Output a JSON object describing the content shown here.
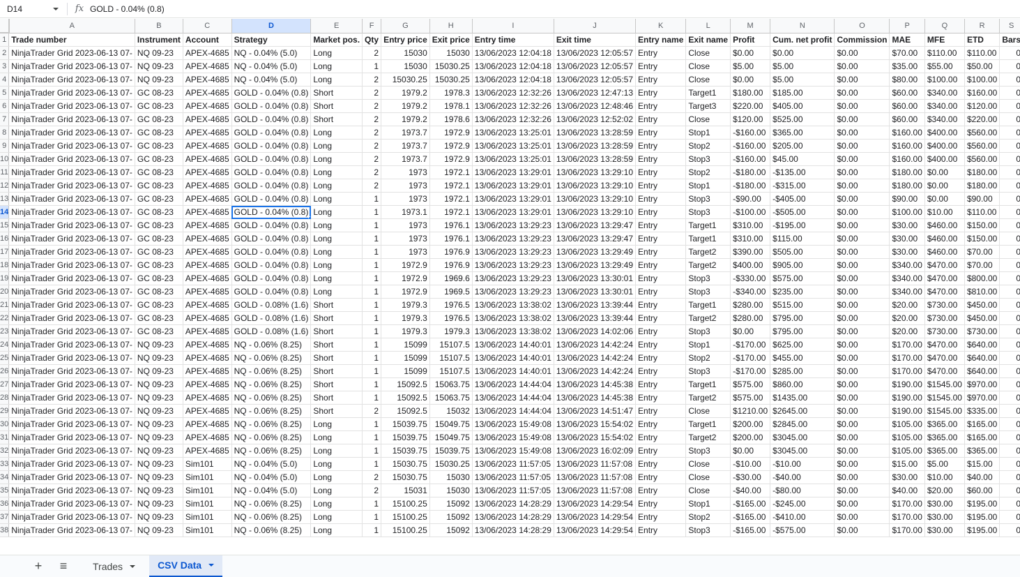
{
  "formula_bar": {
    "cell_ref": "D14",
    "fx": "fx",
    "formula": "GOLD - 0.04% (0.8)"
  },
  "selected": {
    "row": 14,
    "col": "D"
  },
  "columns": [
    "A",
    "B",
    "C",
    "D",
    "E",
    "F",
    "G",
    "H",
    "I",
    "J",
    "K",
    "L",
    "M",
    "N",
    "O",
    "P",
    "Q",
    "R",
    "S"
  ],
  "numeric_columns": [
    "F",
    "G",
    "H",
    "S"
  ],
  "headers": [
    "Trade number",
    "Instrument",
    "Account",
    "Strategy",
    "Market pos.",
    "Qty",
    "Entry price",
    "Exit price",
    "Entry time",
    "Exit time",
    "Entry name",
    "Exit name",
    "Profit",
    "Cum. net profit",
    "Commission",
    "MAE",
    "MFE",
    "ETD",
    "Bars"
  ],
  "rows": [
    [
      "NinjaTrader Grid 2023-06-13 07-",
      "NQ 09-23",
      "APEX-4685",
      "NQ - 0.04% (5.0)",
      "Long",
      "2",
      "15030",
      "15030",
      "13/06/2023 12:04:18",
      "13/06/2023 12:05:57",
      "Entry",
      "Close",
      "$0.00",
      "$0.00",
      "$0.00",
      "$70.00",
      "$110.00",
      "$110.00",
      "0"
    ],
    [
      "NinjaTrader Grid 2023-06-13 07-",
      "NQ 09-23",
      "APEX-4685",
      "NQ - 0.04% (5.0)",
      "Long",
      "1",
      "15030",
      "15030.25",
      "13/06/2023 12:04:18",
      "13/06/2023 12:05:57",
      "Entry",
      "Close",
      "$5.00",
      "$5.00",
      "$0.00",
      "$35.00",
      "$55.00",
      "$50.00",
      "0"
    ],
    [
      "NinjaTrader Grid 2023-06-13 07-",
      "NQ 09-23",
      "APEX-4685",
      "NQ - 0.04% (5.0)",
      "Long",
      "2",
      "15030.25",
      "15030.25",
      "13/06/2023 12:04:18",
      "13/06/2023 12:05:57",
      "Entry",
      "Close",
      "$0.00",
      "$5.00",
      "$0.00",
      "$80.00",
      "$100.00",
      "$100.00",
      "0"
    ],
    [
      "NinjaTrader Grid 2023-06-13 07-",
      "GC 08-23",
      "APEX-4685",
      "GOLD - 0.04% (0.8)",
      "Short",
      "2",
      "1979.2",
      "1978.3",
      "13/06/2023 12:32:26",
      "13/06/2023 12:47:13",
      "Entry",
      "Target1",
      "$180.00",
      "$185.00",
      "$0.00",
      "$60.00",
      "$340.00",
      "$160.00",
      "0"
    ],
    [
      "NinjaTrader Grid 2023-06-13 07-",
      "GC 08-23",
      "APEX-4685",
      "GOLD - 0.04% (0.8)",
      "Short",
      "2",
      "1979.2",
      "1978.1",
      "13/06/2023 12:32:26",
      "13/06/2023 12:48:46",
      "Entry",
      "Target3",
      "$220.00",
      "$405.00",
      "$0.00",
      "$60.00",
      "$340.00",
      "$120.00",
      "0"
    ],
    [
      "NinjaTrader Grid 2023-06-13 07-",
      "GC 08-23",
      "APEX-4685",
      "GOLD - 0.04% (0.8)",
      "Short",
      "2",
      "1979.2",
      "1978.6",
      "13/06/2023 12:32:26",
      "13/06/2023 12:52:02",
      "Entry",
      "Close",
      "$120.00",
      "$525.00",
      "$0.00",
      "$60.00",
      "$340.00",
      "$220.00",
      "0"
    ],
    [
      "NinjaTrader Grid 2023-06-13 07-",
      "GC 08-23",
      "APEX-4685",
      "GOLD - 0.04% (0.8)",
      "Long",
      "2",
      "1973.7",
      "1972.9",
      "13/06/2023 13:25:01",
      "13/06/2023 13:28:59",
      "Entry",
      "Stop1",
      "-$160.00",
      "$365.00",
      "$0.00",
      "$160.00",
      "$400.00",
      "$560.00",
      "0"
    ],
    [
      "NinjaTrader Grid 2023-06-13 07-",
      "GC 08-23",
      "APEX-4685",
      "GOLD - 0.04% (0.8)",
      "Long",
      "2",
      "1973.7",
      "1972.9",
      "13/06/2023 13:25:01",
      "13/06/2023 13:28:59",
      "Entry",
      "Stop2",
      "-$160.00",
      "$205.00",
      "$0.00",
      "$160.00",
      "$400.00",
      "$560.00",
      "0"
    ],
    [
      "NinjaTrader Grid 2023-06-13 07-",
      "GC 08-23",
      "APEX-4685",
      "GOLD - 0.04% (0.8)",
      "Long",
      "2",
      "1973.7",
      "1972.9",
      "13/06/2023 13:25:01",
      "13/06/2023 13:28:59",
      "Entry",
      "Stop3",
      "-$160.00",
      "$45.00",
      "$0.00",
      "$160.00",
      "$400.00",
      "$560.00",
      "0"
    ],
    [
      "NinjaTrader Grid 2023-06-13 07-",
      "GC 08-23",
      "APEX-4685",
      "GOLD - 0.04% (0.8)",
      "Long",
      "2",
      "1973",
      "1972.1",
      "13/06/2023 13:29:01",
      "13/06/2023 13:29:10",
      "Entry",
      "Stop2",
      "-$180.00",
      "-$135.00",
      "$0.00",
      "$180.00",
      "$0.00",
      "$180.00",
      "0"
    ],
    [
      "NinjaTrader Grid 2023-06-13 07-",
      "GC 08-23",
      "APEX-4685",
      "GOLD - 0.04% (0.8)",
      "Long",
      "2",
      "1973",
      "1972.1",
      "13/06/2023 13:29:01",
      "13/06/2023 13:29:10",
      "Entry",
      "Stop1",
      "-$180.00",
      "-$315.00",
      "$0.00",
      "$180.00",
      "$0.00",
      "$180.00",
      "0"
    ],
    [
      "NinjaTrader Grid 2023-06-13 07-",
      "GC 08-23",
      "APEX-4685",
      "GOLD - 0.04% (0.8)",
      "Long",
      "1",
      "1973",
      "1972.1",
      "13/06/2023 13:29:01",
      "13/06/2023 13:29:10",
      "Entry",
      "Stop3",
      "-$90.00",
      "-$405.00",
      "$0.00",
      "$90.00",
      "$0.00",
      "$90.00",
      "0"
    ],
    [
      "NinjaTrader Grid 2023-06-13 07-",
      "GC 08-23",
      "APEX-4685",
      "GOLD - 0.04% (0.8)",
      "Long",
      "1",
      "1973.1",
      "1972.1",
      "13/06/2023 13:29:01",
      "13/06/2023 13:29:10",
      "Entry",
      "Stop3",
      "-$100.00",
      "-$505.00",
      "$0.00",
      "$100.00",
      "$10.00",
      "$110.00",
      "0"
    ],
    [
      "NinjaTrader Grid 2023-06-13 07-",
      "GC 08-23",
      "APEX-4685",
      "GOLD - 0.04% (0.8)",
      "Long",
      "1",
      "1973",
      "1976.1",
      "13/06/2023 13:29:23",
      "13/06/2023 13:29:47",
      "Entry",
      "Target1",
      "$310.00",
      "-$195.00",
      "$0.00",
      "$30.00",
      "$460.00",
      "$150.00",
      "0"
    ],
    [
      "NinjaTrader Grid 2023-06-13 07-",
      "GC 08-23",
      "APEX-4685",
      "GOLD - 0.04% (0.8)",
      "Long",
      "1",
      "1973",
      "1976.1",
      "13/06/2023 13:29:23",
      "13/06/2023 13:29:47",
      "Entry",
      "Target1",
      "$310.00",
      "$115.00",
      "$0.00",
      "$30.00",
      "$460.00",
      "$150.00",
      "0"
    ],
    [
      "NinjaTrader Grid 2023-06-13 07-",
      "GC 08-23",
      "APEX-4685",
      "GOLD - 0.04% (0.8)",
      "Long",
      "1",
      "1973",
      "1976.9",
      "13/06/2023 13:29:23",
      "13/06/2023 13:29:49",
      "Entry",
      "Target2",
      "$390.00",
      "$505.00",
      "$0.00",
      "$30.00",
      "$460.00",
      "$70.00",
      "0"
    ],
    [
      "NinjaTrader Grid 2023-06-13 07-",
      "GC 08-23",
      "APEX-4685",
      "GOLD - 0.04% (0.8)",
      "Long",
      "1",
      "1972.9",
      "1976.9",
      "13/06/2023 13:29:23",
      "13/06/2023 13:29:49",
      "Entry",
      "Target2",
      "$400.00",
      "$905.00",
      "$0.00",
      "$340.00",
      "$470.00",
      "$70.00",
      "0"
    ],
    [
      "NinjaTrader Grid 2023-06-13 07-",
      "GC 08-23",
      "APEX-4685",
      "GOLD - 0.04% (0.8)",
      "Long",
      "1",
      "1972.9",
      "1969.6",
      "13/06/2023 13:29:23",
      "13/06/2023 13:30:01",
      "Entry",
      "Stop3",
      "-$330.00",
      "$575.00",
      "$0.00",
      "$340.00",
      "$470.00",
      "$800.00",
      "0"
    ],
    [
      "NinjaTrader Grid 2023-06-13 07-",
      "GC 08-23",
      "APEX-4685",
      "GOLD - 0.04% (0.8)",
      "Long",
      "1",
      "1972.9",
      "1969.5",
      "13/06/2023 13:29:23",
      "13/06/2023 13:30:01",
      "Entry",
      "Stop3",
      "-$340.00",
      "$235.00",
      "$0.00",
      "$340.00",
      "$470.00",
      "$810.00",
      "0"
    ],
    [
      "NinjaTrader Grid 2023-06-13 07-",
      "GC 08-23",
      "APEX-4685",
      "GOLD - 0.08% (1.6)",
      "Short",
      "1",
      "1979.3",
      "1976.5",
      "13/06/2023 13:38:02",
      "13/06/2023 13:39:44",
      "Entry",
      "Target1",
      "$280.00",
      "$515.00",
      "$0.00",
      "$20.00",
      "$730.00",
      "$450.00",
      "0"
    ],
    [
      "NinjaTrader Grid 2023-06-13 07-",
      "GC 08-23",
      "APEX-4685",
      "GOLD - 0.08% (1.6)",
      "Short",
      "1",
      "1979.3",
      "1976.5",
      "13/06/2023 13:38:02",
      "13/06/2023 13:39:44",
      "Entry",
      "Target2",
      "$280.00",
      "$795.00",
      "$0.00",
      "$20.00",
      "$730.00",
      "$450.00",
      "0"
    ],
    [
      "NinjaTrader Grid 2023-06-13 07-",
      "GC 08-23",
      "APEX-4685",
      "GOLD - 0.08% (1.6)",
      "Short",
      "1",
      "1979.3",
      "1979.3",
      "13/06/2023 13:38:02",
      "13/06/2023 14:02:06",
      "Entry",
      "Stop3",
      "$0.00",
      "$795.00",
      "$0.00",
      "$20.00",
      "$730.00",
      "$730.00",
      "0"
    ],
    [
      "NinjaTrader Grid 2023-06-13 07-",
      "NQ 09-23",
      "APEX-4685",
      "NQ - 0.06% (8.25)",
      "Short",
      "1",
      "15099",
      "15107.5",
      "13/06/2023 14:40:01",
      "13/06/2023 14:42:24",
      "Entry",
      "Stop1",
      "-$170.00",
      "$625.00",
      "$0.00",
      "$170.00",
      "$470.00",
      "$640.00",
      "0"
    ],
    [
      "NinjaTrader Grid 2023-06-13 07-",
      "NQ 09-23",
      "APEX-4685",
      "NQ - 0.06% (8.25)",
      "Short",
      "1",
      "15099",
      "15107.5",
      "13/06/2023 14:40:01",
      "13/06/2023 14:42:24",
      "Entry",
      "Stop2",
      "-$170.00",
      "$455.00",
      "$0.00",
      "$170.00",
      "$470.00",
      "$640.00",
      "0"
    ],
    [
      "NinjaTrader Grid 2023-06-13 07-",
      "NQ 09-23",
      "APEX-4685",
      "NQ - 0.06% (8.25)",
      "Short",
      "1",
      "15099",
      "15107.5",
      "13/06/2023 14:40:01",
      "13/06/2023 14:42:24",
      "Entry",
      "Stop3",
      "-$170.00",
      "$285.00",
      "$0.00",
      "$170.00",
      "$470.00",
      "$640.00",
      "0"
    ],
    [
      "NinjaTrader Grid 2023-06-13 07-",
      "NQ 09-23",
      "APEX-4685",
      "NQ - 0.06% (8.25)",
      "Short",
      "1",
      "15092.5",
      "15063.75",
      "13/06/2023 14:44:04",
      "13/06/2023 14:45:38",
      "Entry",
      "Target1",
      "$575.00",
      "$860.00",
      "$0.00",
      "$190.00",
      "$1545.00",
      "$970.00",
      "0"
    ],
    [
      "NinjaTrader Grid 2023-06-13 07-",
      "NQ 09-23",
      "APEX-4685",
      "NQ - 0.06% (8.25)",
      "Short",
      "1",
      "15092.5",
      "15063.75",
      "13/06/2023 14:44:04",
      "13/06/2023 14:45:38",
      "Entry",
      "Target2",
      "$575.00",
      "$1435.00",
      "$0.00",
      "$190.00",
      "$1545.00",
      "$970.00",
      "0"
    ],
    [
      "NinjaTrader Grid 2023-06-13 07-",
      "NQ 09-23",
      "APEX-4685",
      "NQ - 0.06% (8.25)",
      "Short",
      "2",
      "15092.5",
      "15032",
      "13/06/2023 14:44:04",
      "13/06/2023 14:51:47",
      "Entry",
      "Close",
      "$1210.00",
      "$2645.00",
      "$0.00",
      "$190.00",
      "$1545.00",
      "$335.00",
      "0"
    ],
    [
      "NinjaTrader Grid 2023-06-13 07-",
      "NQ 09-23",
      "APEX-4685",
      "NQ - 0.06% (8.25)",
      "Long",
      "1",
      "15039.75",
      "15049.75",
      "13/06/2023 15:49:08",
      "13/06/2023 15:54:02",
      "Entry",
      "Target1",
      "$200.00",
      "$2845.00",
      "$0.00",
      "$105.00",
      "$365.00",
      "$165.00",
      "0"
    ],
    [
      "NinjaTrader Grid 2023-06-13 07-",
      "NQ 09-23",
      "APEX-4685",
      "NQ - 0.06% (8.25)",
      "Long",
      "1",
      "15039.75",
      "15049.75",
      "13/06/2023 15:49:08",
      "13/06/2023 15:54:02",
      "Entry",
      "Target2",
      "$200.00",
      "$3045.00",
      "$0.00",
      "$105.00",
      "$365.00",
      "$165.00",
      "0"
    ],
    [
      "NinjaTrader Grid 2023-06-13 07-",
      "NQ 09-23",
      "APEX-4685",
      "NQ - 0.06% (8.25)",
      "Long",
      "1",
      "15039.75",
      "15039.75",
      "13/06/2023 15:49:08",
      "13/06/2023 16:02:09",
      "Entry",
      "Stop3",
      "$0.00",
      "$3045.00",
      "$0.00",
      "$105.00",
      "$365.00",
      "$365.00",
      "0"
    ],
    [
      "NinjaTrader Grid 2023-06-13 07-",
      "NQ 09-23",
      "Sim101",
      "NQ - 0.04% (5.0)",
      "Long",
      "1",
      "15030.75",
      "15030.25",
      "13/06/2023 11:57:05",
      "13/06/2023 11:57:08",
      "Entry",
      "Close",
      "-$10.00",
      "-$10.00",
      "$0.00",
      "$15.00",
      "$5.00",
      "$15.00",
      "0"
    ],
    [
      "NinjaTrader Grid 2023-06-13 07-",
      "NQ 09-23",
      "Sim101",
      "NQ - 0.04% (5.0)",
      "Long",
      "2",
      "15030.75",
      "15030",
      "13/06/2023 11:57:05",
      "13/06/2023 11:57:08",
      "Entry",
      "Close",
      "-$30.00",
      "-$40.00",
      "$0.00",
      "$30.00",
      "$10.00",
      "$40.00",
      "0"
    ],
    [
      "NinjaTrader Grid 2023-06-13 07-",
      "NQ 09-23",
      "Sim101",
      "NQ - 0.04% (5.0)",
      "Long",
      "2",
      "15031",
      "15030",
      "13/06/2023 11:57:05",
      "13/06/2023 11:57:08",
      "Entry",
      "Close",
      "-$40.00",
      "-$80.00",
      "$0.00",
      "$40.00",
      "$20.00",
      "$60.00",
      "0"
    ],
    [
      "NinjaTrader Grid 2023-06-13 07-",
      "NQ 09-23",
      "Sim101",
      "NQ - 0.06% (8.25)",
      "Long",
      "1",
      "15100.25",
      "15092",
      "13/06/2023 14:28:29",
      "13/06/2023 14:29:54",
      "Entry",
      "Stop1",
      "-$165.00",
      "-$245.00",
      "$0.00",
      "$170.00",
      "$30.00",
      "$195.00",
      "0"
    ],
    [
      "NinjaTrader Grid 2023-06-13 07-",
      "NQ 09-23",
      "Sim101",
      "NQ - 0.06% (8.25)",
      "Long",
      "1",
      "15100.25",
      "15092",
      "13/06/2023 14:28:29",
      "13/06/2023 14:29:54",
      "Entry",
      "Stop2",
      "-$165.00",
      "-$410.00",
      "$0.00",
      "$170.00",
      "$30.00",
      "$195.00",
      "0"
    ],
    [
      "NinjaTrader Grid 2023-06-13 07-",
      "NQ 09-23",
      "Sim101",
      "NQ - 0.06% (8.25)",
      "Long",
      "1",
      "15100.25",
      "15092",
      "13/06/2023 14:28:29",
      "13/06/2023 14:29:54",
      "Entry",
      "Stop3",
      "-$165.00",
      "-$575.00",
      "$0.00",
      "$170.00",
      "$30.00",
      "$195.00",
      "0"
    ]
  ],
  "sheet_tabs": {
    "add_icon": "+",
    "menu_icon": "≡",
    "tabs": [
      {
        "label": "Trades",
        "active": false
      },
      {
        "label": "CSV Data",
        "active": true
      }
    ]
  },
  "colors": {
    "selection": "#1a73e8",
    "header_highlight": "#d3e3fd",
    "active_tab_text": "#0b57d0"
  }
}
